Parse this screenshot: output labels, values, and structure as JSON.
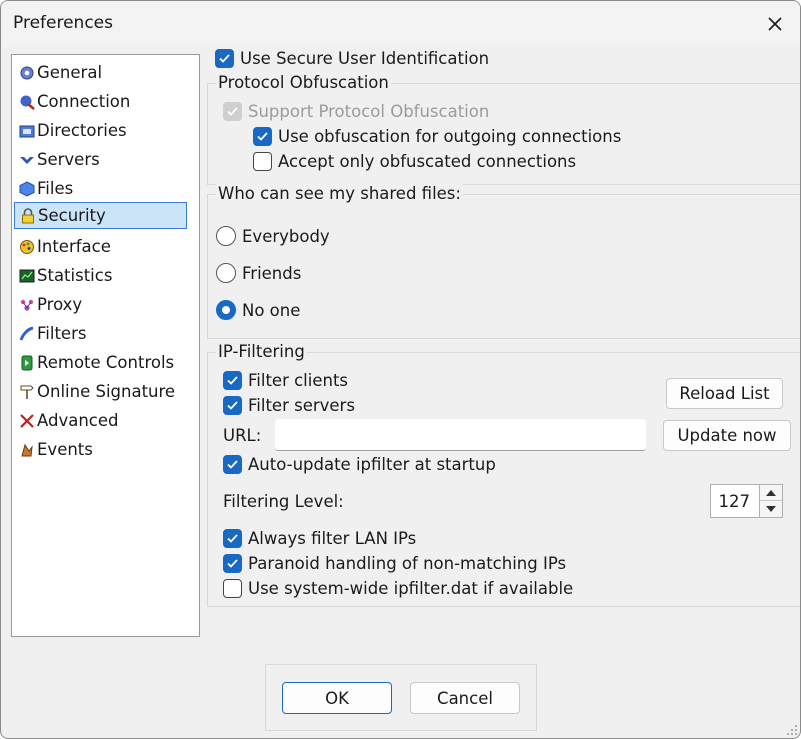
{
  "window": {
    "title": "Preferences"
  },
  "nav": {
    "items": [
      {
        "label": "General",
        "icon": "gear-icon"
      },
      {
        "label": "Connection",
        "icon": "connection-icon"
      },
      {
        "label": "Directories",
        "icon": "folder-icon"
      },
      {
        "label": "Servers",
        "icon": "server-icon"
      },
      {
        "label": "Files",
        "icon": "file-cube-icon"
      },
      {
        "label": "Security",
        "icon": "lock-icon"
      },
      {
        "label": "Interface",
        "icon": "palette-icon"
      },
      {
        "label": "Statistics",
        "icon": "chart-monitor-icon"
      },
      {
        "label": "Proxy",
        "icon": "proxy-icon"
      },
      {
        "label": "Filters",
        "icon": "filter-icon"
      },
      {
        "label": "Remote Controls",
        "icon": "remote-icon"
      },
      {
        "label": "Online Signature",
        "icon": "signpost-icon"
      },
      {
        "label": "Advanced",
        "icon": "cross-tools-icon"
      },
      {
        "label": "Events",
        "icon": "events-icon"
      }
    ],
    "selected": "Security"
  },
  "security": {
    "secure_user_id": {
      "label": "Use Secure User Identification",
      "checked": true
    },
    "obfuscation": {
      "title": "Protocol Obfuscation",
      "support": {
        "label": "Support Protocol Obfuscation",
        "checked": true,
        "disabled": true
      },
      "outgoing": {
        "label": "Use obfuscation for outgoing connections",
        "checked": true
      },
      "only_obfuscated": {
        "label": "Accept only obfuscated connections",
        "checked": false
      }
    },
    "shared_files": {
      "title": "Who can see my shared files:",
      "options": [
        "Everybody",
        "Friends",
        "No one"
      ],
      "selected": "No one"
    },
    "ip_filtering": {
      "title": "IP-Filtering",
      "filter_clients": {
        "label": "Filter clients",
        "checked": true
      },
      "filter_servers": {
        "label": "Filter servers",
        "checked": true
      },
      "reload_button": "Reload List",
      "url_label": "URL:",
      "url_value": "",
      "update_button": "Update now",
      "auto_update": {
        "label": "Auto-update ipfilter at startup",
        "checked": true
      },
      "filtering_level_label": "Filtering Level:",
      "filtering_level": "127",
      "filter_lan": {
        "label": "Always filter LAN IPs",
        "checked": true
      },
      "paranoid": {
        "label": "Paranoid handling of non-matching IPs",
        "checked": true
      },
      "system_wide": {
        "label": "Use system-wide ipfilter.dat if available",
        "checked": false
      }
    }
  },
  "footer": {
    "ok": "OK",
    "cancel": "Cancel"
  },
  "colors": {
    "accent": "#1769c4",
    "selection": "#cce4f7",
    "background": "#f0f0f0"
  }
}
